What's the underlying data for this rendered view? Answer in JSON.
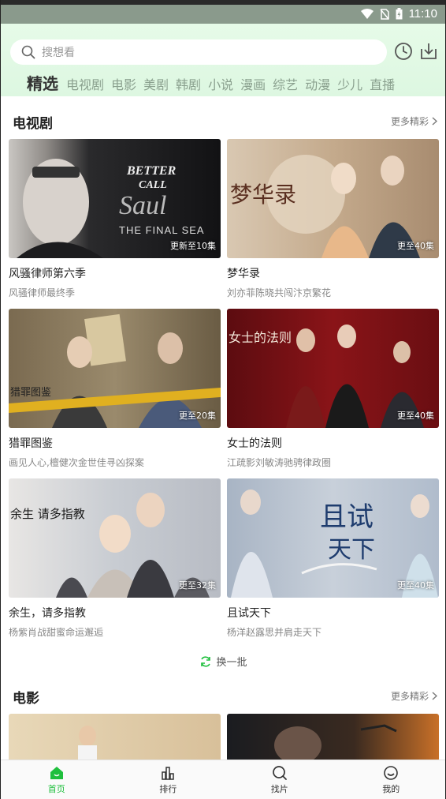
{
  "status": {
    "time": "11:10"
  },
  "search": {
    "placeholder": "搜想看"
  },
  "tabs": [
    "精选",
    "电视剧",
    "电影",
    "美剧",
    "韩剧",
    "小说",
    "漫画",
    "综艺",
    "动漫",
    "少儿",
    "直播"
  ],
  "tv_section": {
    "title": "电视剧",
    "more": "更多精彩",
    "cards": [
      {
        "title": "风骚律师第六季",
        "sub": "风骚律师最终季",
        "badge": "更新至10集",
        "poster_text": "BETTER CALL Saul THE FINAL SEA"
      },
      {
        "title": "梦华录",
        "sub": "刘亦菲陈晓共闯汴京繁花",
        "badge": "更至40集",
        "poster_text": "梦华录"
      },
      {
        "title": "猎罪图鉴",
        "sub": "画见人心,檀健次金世佳寻凶探案",
        "badge": "更至20集",
        "poster_text": "猎罪图鉴"
      },
      {
        "title": "女士的法则",
        "sub": "江疏影刘敏涛驰骋律政圈",
        "badge": "更至40集",
        "poster_text": "女士的法则"
      },
      {
        "title": "余生，请多指教",
        "sub": "杨紫肖战甜蜜命运邂逅",
        "badge": "更至32集",
        "poster_text": "余生 请多指教"
      },
      {
        "title": "且试天下",
        "sub": "杨洋赵露思并肩走天下",
        "badge": "更至40集",
        "poster_text": "且试天下"
      }
    ],
    "refresh": "换一批"
  },
  "movie_section": {
    "title": "电影",
    "more": "更多精彩"
  },
  "bottom_nav": [
    {
      "label": "首页",
      "icon": "home-icon"
    },
    {
      "label": "排行",
      "icon": "ranking-icon"
    },
    {
      "label": "找片",
      "icon": "search-icon"
    },
    {
      "label": "我的",
      "icon": "profile-icon"
    }
  ],
  "colors": {
    "accent": "#1fbf3d",
    "header_bg": "#e3faе6"
  }
}
